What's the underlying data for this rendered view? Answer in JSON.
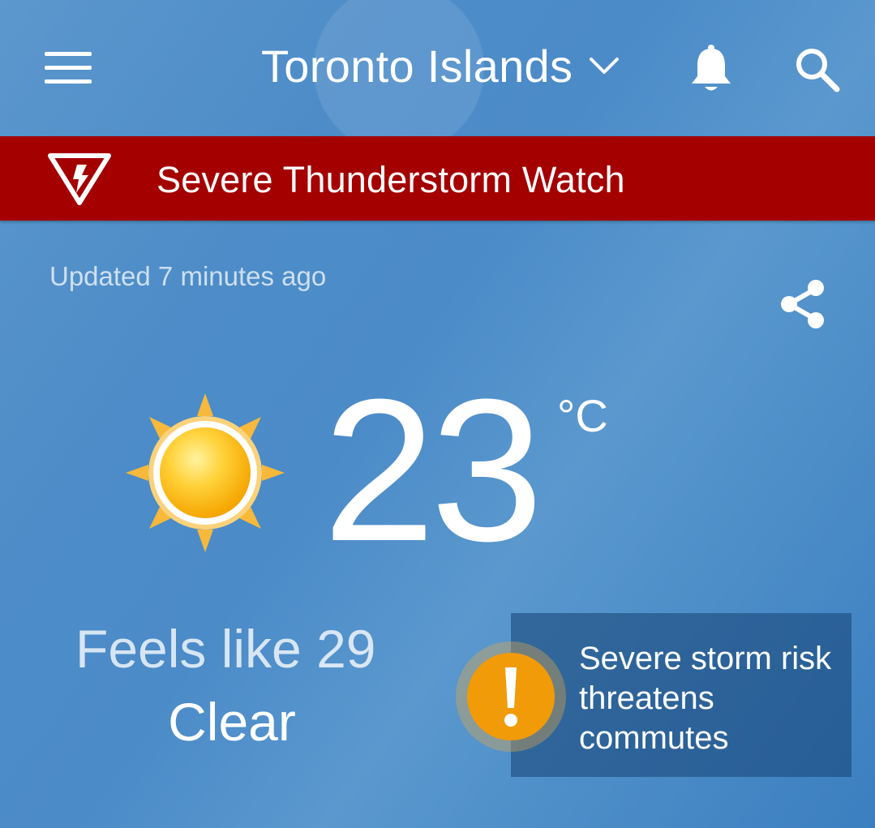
{
  "header": {
    "location": "Toronto Islands",
    "icons": {
      "menu": "menu-icon",
      "location_dropdown": "chevron-down-icon",
      "notifications": "bell-icon",
      "search": "search-icon"
    }
  },
  "alert": {
    "icon": "lightning-warning-icon",
    "text": "Severe Thunderstorm Watch",
    "color": "#a40000"
  },
  "current": {
    "updated": "Updated 7 minutes ago",
    "share_icon": "share-icon",
    "condition_icon": "sun-icon",
    "temperature": "23",
    "unit": "°C",
    "feels_like": "Feels like 29",
    "condition": "Clear"
  },
  "news_card": {
    "icon": "exclamation-icon",
    "icon_color": "#f19b08",
    "headline": "Severe storm risk threatens commutes"
  }
}
